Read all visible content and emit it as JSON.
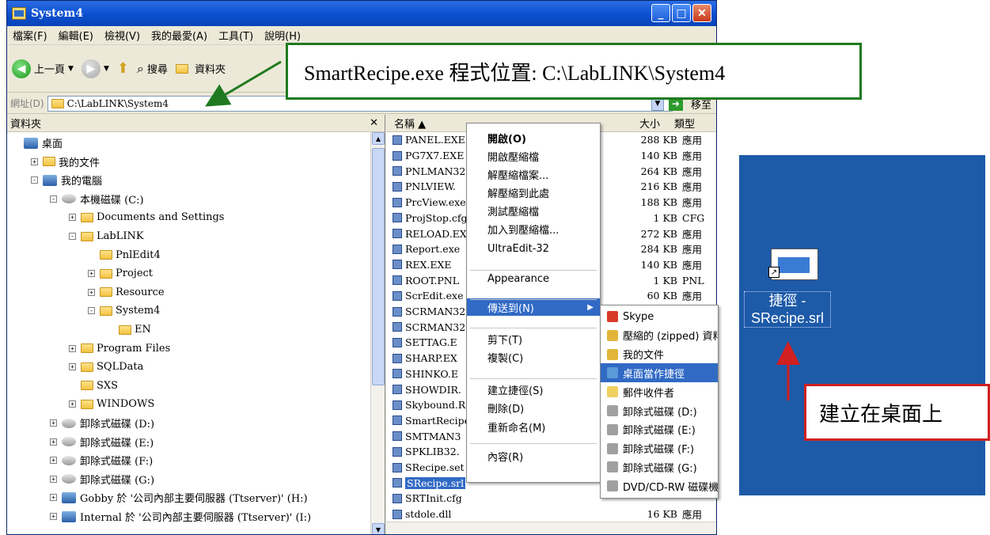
{
  "window": {
    "title": "System4",
    "menu": [
      "檔案(F)",
      "編輯(E)",
      "檢視(V)",
      "我的最愛(A)",
      "工具(T)",
      "說明(H)"
    ],
    "toolbar": {
      "back": "上一頁",
      "search": "搜尋",
      "folders": "資料夾"
    },
    "address": {
      "label": "網址(D)",
      "value": "C:\\LabLINK\\System4",
      "go": "移至"
    }
  },
  "folders_pane": {
    "title": "資料夾",
    "tree": [
      {
        "label": "桌面",
        "level": 0,
        "expander": "",
        "icon": "desktop"
      },
      {
        "label": "我的文件",
        "level": 1,
        "expander": "+",
        "icon": "folder"
      },
      {
        "label": "我的電腦",
        "level": 1,
        "expander": "-",
        "icon": "computer"
      },
      {
        "label": "本機磁碟 (C:)",
        "level": 2,
        "expander": "-",
        "icon": "drive"
      },
      {
        "label": "Documents and Settings",
        "level": 3,
        "expander": "+",
        "icon": "folder"
      },
      {
        "label": "LabLINK",
        "level": 3,
        "expander": "-",
        "icon": "folder"
      },
      {
        "label": "PnlEdit4",
        "level": 4,
        "expander": "",
        "icon": "folder"
      },
      {
        "label": "Project",
        "level": 4,
        "expander": "+",
        "icon": "folder"
      },
      {
        "label": "Resource",
        "level": 4,
        "expander": "+",
        "icon": "folder"
      },
      {
        "label": "System4",
        "level": 4,
        "expander": "-",
        "icon": "folder"
      },
      {
        "label": "EN",
        "level": 5,
        "expander": "",
        "icon": "folder"
      },
      {
        "label": "Program Files",
        "level": 3,
        "expander": "+",
        "icon": "folder"
      },
      {
        "label": "SQLData",
        "level": 3,
        "expander": "+",
        "icon": "folder"
      },
      {
        "label": "SXS",
        "level": 3,
        "expander": "",
        "icon": "folder"
      },
      {
        "label": "WINDOWS",
        "level": 3,
        "expander": "+",
        "icon": "folder"
      },
      {
        "label": "卸除式磁碟 (D:)",
        "level": 2,
        "expander": "+",
        "icon": "drive"
      },
      {
        "label": "卸除式磁碟 (E:)",
        "level": 2,
        "expander": "+",
        "icon": "drive"
      },
      {
        "label": "卸除式磁碟 (F:)",
        "level": 2,
        "expander": "+",
        "icon": "drive"
      },
      {
        "label": "卸除式磁碟 (G:)",
        "level": 2,
        "expander": "+",
        "icon": "drive"
      },
      {
        "label": "Gobby 於 '公司內部主要伺服器 (Ttserver)' (H:)",
        "level": 2,
        "expander": "+",
        "icon": "share"
      },
      {
        "label": "Internal 於 '公司內部主要伺服器 (Ttserver)' (I:)",
        "level": 2,
        "expander": "+",
        "icon": "share"
      }
    ]
  },
  "file_list": {
    "columns": {
      "name": "名稱",
      "size": "大小",
      "type": "類型"
    },
    "files": [
      {
        "name": "PANEL.EXE",
        "size": "288 KB",
        "type": "應用"
      },
      {
        "name": "PG7X7.EXE",
        "size": "140 KB",
        "type": "應用"
      },
      {
        "name": "PNLMAN32",
        "size": "264 KB",
        "type": "應用"
      },
      {
        "name": "PNLVIEW.",
        "size": "216 KB",
        "type": "應用"
      },
      {
        "name": "PrcView.exe",
        "size": "188 KB",
        "type": "應用"
      },
      {
        "name": "ProjStop.cfg",
        "size": "1 KB",
        "type": "CFG"
      },
      {
        "name": "RELOAD.EX",
        "size": "272 KB",
        "type": "應用"
      },
      {
        "name": "Report.exe",
        "size": "284 KB",
        "type": "應用"
      },
      {
        "name": "REX.EXE",
        "size": "140 KB",
        "type": "應用"
      },
      {
        "name": "ROOT.PNL",
        "size": "1 KB",
        "type": "PNL"
      },
      {
        "name": "ScrEdit.exe",
        "size": "60 KB",
        "type": "應用"
      },
      {
        "name": "SCRMAN32",
        "size": "",
        "type": ""
      },
      {
        "name": "SCRMAN32",
        "size": "",
        "type": ""
      },
      {
        "name": "SETTAG.E",
        "size": "",
        "type": ""
      },
      {
        "name": "SHARP.EX",
        "size": "",
        "type": ""
      },
      {
        "name": "SHINKO.E",
        "size": "",
        "type": ""
      },
      {
        "name": "SHOWDIR.",
        "size": "",
        "type": ""
      },
      {
        "name": "Skybound.R",
        "size": "",
        "type": ""
      },
      {
        "name": "SmartRecipe",
        "size": "",
        "type": ""
      },
      {
        "name": "SMTMAN3",
        "size": "",
        "type": ""
      },
      {
        "name": "SPKLIB32.",
        "size": "",
        "type": ""
      },
      {
        "name": "SRecipe.set",
        "size": "",
        "type": ""
      },
      {
        "name": "SRecipe.srl",
        "size": "",
        "type": "",
        "selected": true
      },
      {
        "name": "SRTInit.cfg",
        "size": "",
        "type": ""
      },
      {
        "name": "stdole.dll",
        "size": "16 KB",
        "type": "應用"
      }
    ]
  },
  "context_menu": {
    "items": [
      {
        "label": "開啟(O)",
        "bold": true
      },
      {
        "label": "開啟壓縮檔"
      },
      {
        "label": "解壓縮檔案..."
      },
      {
        "label": "解壓縮到此處"
      },
      {
        "label": "測試壓縮檔"
      },
      {
        "label": "加入到壓縮檔..."
      },
      {
        "label": "UltraEdit-32"
      },
      {
        "label": "Appearance"
      },
      {
        "label": "傳送到(N)",
        "highlighted": true,
        "submenu": true
      },
      {
        "label": "剪下(T)"
      },
      {
        "label": "複製(C)"
      },
      {
        "label": "建立捷徑(S)"
      },
      {
        "label": "刪除(D)"
      },
      {
        "label": "重新命名(M)"
      },
      {
        "label": "內容(R)"
      }
    ]
  },
  "send_to_menu": {
    "items": [
      {
        "label": "Skype",
        "icon": "skype-icon",
        "color": "#d83a2a"
      },
      {
        "label": "壓縮的 (zipped) 資料夾",
        "icon": "zip-folder-icon",
        "color": "#e2b53a"
      },
      {
        "label": "我的文件",
        "icon": "documents-icon",
        "color": "#e2b53a"
      },
      {
        "label": "桌面當作捷徑",
        "icon": "desktop-shortcut-icon",
        "color": "#5a9ad8",
        "highlighted": true
      },
      {
        "label": "郵件收件者",
        "icon": "mail-icon",
        "color": "#f0d060"
      },
      {
        "label": "卸除式磁碟 (D:)",
        "icon": "drive-icon",
        "color": "#a0a0a0"
      },
      {
        "label": "卸除式磁碟 (E:)",
        "icon": "drive-icon",
        "color": "#a0a0a0"
      },
      {
        "label": "卸除式磁碟 (F:)",
        "icon": "drive-icon",
        "color": "#a0a0a0"
      },
      {
        "label": "卸除式磁碟 (G:)",
        "icon": "drive-icon",
        "color": "#a0a0a0"
      },
      {
        "label": "DVD/CD-RW 磁碟機",
        "icon": "dvd-icon",
        "color": "#a0a0a0"
      }
    ]
  },
  "annotations": {
    "location_callout": "SmartRecipe.exe 程式位置: C:\\LabLINK\\System4",
    "desktop_callout": "建立在桌面上",
    "desktop_icon_label_line1": "捷徑 -",
    "desktop_icon_label_line2": "SRecipe.srl"
  },
  "colors": {
    "titlebar": "#0a4fd0",
    "selection": "#316ac5",
    "callout_green": "#1f7a1f",
    "callout_red": "#d02020",
    "desktop_bg": "#1d5aa8"
  }
}
